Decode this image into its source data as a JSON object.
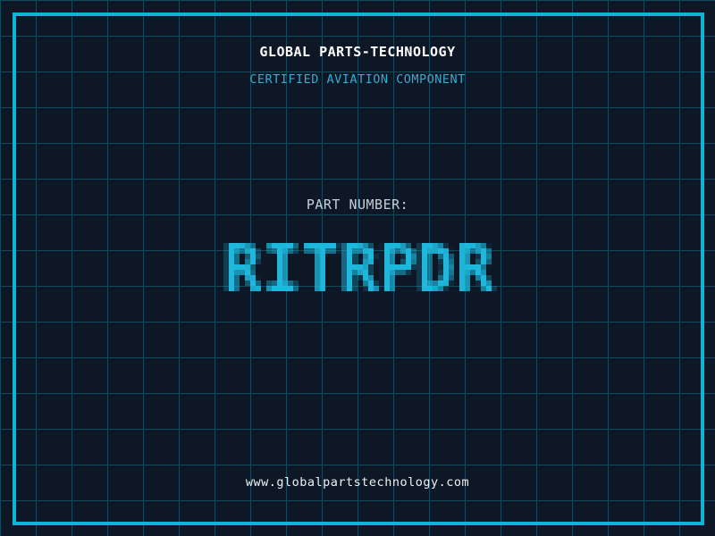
{
  "theme": {
    "background": "#0e1726",
    "grid_line_color": "#17485a",
    "frame_color": "#0cb4d8",
    "part_number_color": "#1fb8dc",
    "company_color": "#ffffff",
    "tagline_color": "#36abcd",
    "label_color": "#c7d0d8",
    "website_color": "#eef2f4"
  },
  "header": {
    "company_name": "GLOBAL PARTS-TECHNOLOGY",
    "tagline": "CERTIFIED AVIATION COMPONENT"
  },
  "part": {
    "label": "PART NUMBER:",
    "number": "RITRPDR"
  },
  "footer": {
    "website": "www.globalpartstechnology.com"
  }
}
